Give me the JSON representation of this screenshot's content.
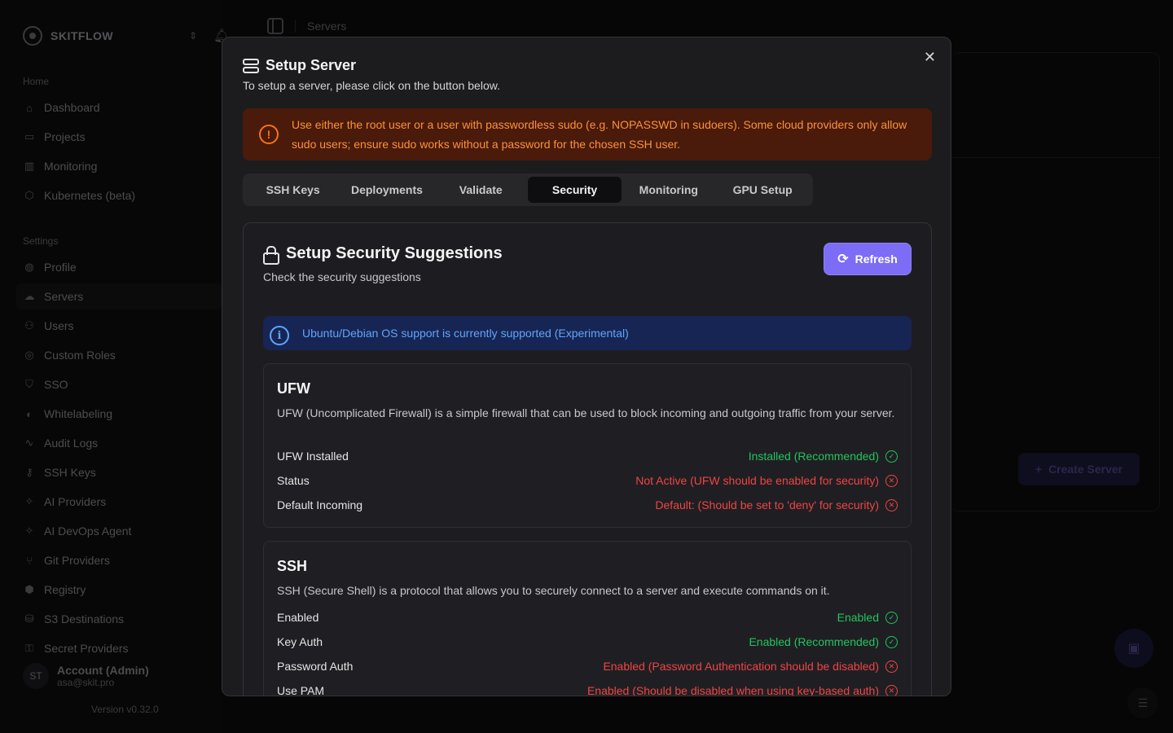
{
  "sidebar": {
    "brand": "SKITFLOW",
    "home_label": "Home",
    "home_items": [
      {
        "label": "Dashboard",
        "icon": "home-icon"
      },
      {
        "label": "Projects",
        "icon": "folder-icon"
      },
      {
        "label": "Monitoring",
        "icon": "chart-icon"
      },
      {
        "label": "Kubernetes (beta)",
        "icon": "hexagon-icon"
      }
    ],
    "settings_label": "Settings",
    "settings_items": [
      {
        "label": "Profile",
        "icon": "globe-icon"
      },
      {
        "label": "Servers",
        "icon": "cloud-icon"
      },
      {
        "label": "Users",
        "icon": "users-icon"
      },
      {
        "label": "Custom Roles",
        "icon": "roles-icon"
      },
      {
        "label": "SSO",
        "icon": "shield-icon"
      },
      {
        "label": "Whitelabeling",
        "icon": "palette-icon"
      },
      {
        "label": "Audit Logs",
        "icon": "activity-icon"
      },
      {
        "label": "SSH Keys",
        "icon": "key-icon"
      },
      {
        "label": "AI Providers",
        "icon": "sparkle-icon"
      },
      {
        "label": "AI DevOps Agent",
        "icon": "sparkle-icon"
      },
      {
        "label": "Git Providers",
        "icon": "git-icon"
      },
      {
        "label": "Registry",
        "icon": "package-icon"
      },
      {
        "label": "S3 Destinations",
        "icon": "database-icon"
      },
      {
        "label": "Secret Providers",
        "icon": "lock-icon"
      }
    ],
    "account": {
      "initials": "ST",
      "name": "Account (Admin)",
      "email": "asa@skit.pro"
    },
    "version": "Version v0.32.0"
  },
  "topbar": {
    "breadcrumb": "Servers"
  },
  "background": {
    "create_server_label": "Create Server"
  },
  "modal": {
    "title": "Setup Server",
    "subtitle": "To setup a server, please click on the button below.",
    "warning": "Use either the root user or a user with passwordless sudo (e.g. NOPASSWD in sudoers). Some cloud providers only allow sudo users; ensure sudo works without a password for the chosen SSH user.",
    "tabs": [
      "SSH Keys",
      "Deployments",
      "Validate",
      "Security",
      "Monitoring",
      "GPU Setup"
    ],
    "active_tab": "Security",
    "panel": {
      "title": "Setup Security Suggestions",
      "subtitle": "Check the security suggestions",
      "refresh_label": "Refresh",
      "info": "Ubuntu/Debian OS support is currently supported (Experimental)",
      "sections": [
        {
          "title": "UFW",
          "description": "UFW (Uncomplicated Firewall) is a simple firewall that can be used to block incoming and outgoing traffic from your server.",
          "rows": [
            {
              "label": "UFW Installed",
              "value": "Installed (Recommended)",
              "status": "ok"
            },
            {
              "label": "Status",
              "value": "Not Active (UFW should be enabled for security)",
              "status": "bad"
            },
            {
              "label": "Default Incoming",
              "value": "Default: (Should be set to 'deny' for security)",
              "status": "bad"
            }
          ]
        },
        {
          "title": "SSH",
          "description": "SSH (Secure Shell) is a protocol that allows you to securely connect to a server and execute commands on it.",
          "rows": [
            {
              "label": "Enabled",
              "value": "Enabled",
              "status": "ok"
            },
            {
              "label": "Key Auth",
              "value": "Enabled (Recommended)",
              "status": "ok"
            },
            {
              "label": "Password Auth",
              "value": "Enabled (Password Authentication should be disabled)",
              "status": "bad"
            },
            {
              "label": "Use PAM",
              "value": "Enabled (Should be disabled when using key-based auth)",
              "status": "bad"
            }
          ]
        }
      ]
    }
  },
  "colors": {
    "accent": "#7c6cf6",
    "ok": "#22c55e",
    "bad": "#ef4444",
    "warning": "#fb923c",
    "info": "#60a5fa"
  }
}
